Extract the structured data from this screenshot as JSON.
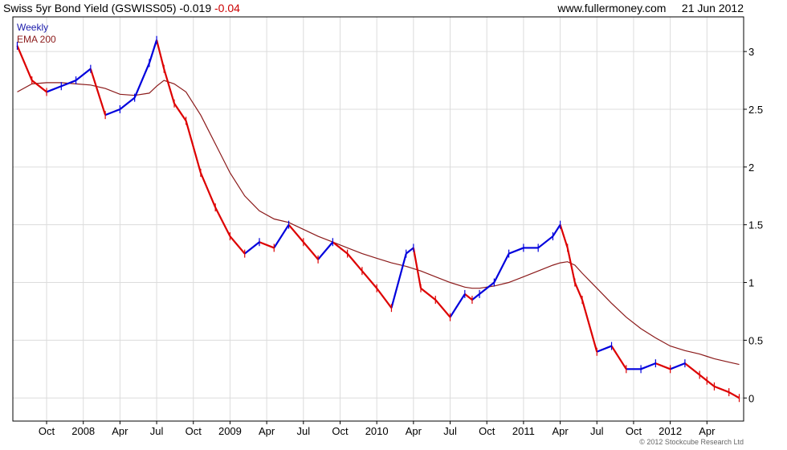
{
  "header": {
    "title": "Swiss 5yr Bond Yield (GSWISS05)",
    "last_value": "-0.019",
    "change": "-0.04",
    "site": "www.fullermoney.com",
    "date": "21 Jun 2012"
  },
  "legend": {
    "weekly": "Weekly",
    "ema": "EMA 200"
  },
  "footer": {
    "copyright": "© 2012 Stockcube Research Ltd"
  },
  "chart_data": {
    "type": "line",
    "x": [
      2007.55,
      2007.65,
      2007.75,
      2007.85,
      2007.95,
      2008.05,
      2008.15,
      2008.25,
      2008.35,
      2008.45,
      2008.5,
      2008.55,
      2008.62,
      2008.7,
      2008.8,
      2008.9,
      2009.0,
      2009.1,
      2009.2,
      2009.3,
      2009.4,
      2009.5,
      2009.6,
      2009.7,
      2009.8,
      2009.9,
      2010.0,
      2010.1,
      2010.2,
      2010.25,
      2010.3,
      2010.4,
      2010.5,
      2010.6,
      2010.65,
      2010.7,
      2010.8,
      2010.9,
      2011.0,
      2011.1,
      2011.2,
      2011.25,
      2011.3,
      2011.35,
      2011.4,
      2011.5,
      2011.6,
      2011.7,
      2011.8,
      2011.9,
      2012.0,
      2012.1,
      2012.2,
      2012.25,
      2012.3,
      2012.4,
      2012.47
    ],
    "series": [
      {
        "name": "Weekly",
        "color_up": "#0000dd",
        "color_down": "#dd0000",
        "values": [
          3.05,
          2.75,
          2.65,
          2.7,
          2.75,
          2.85,
          2.45,
          2.5,
          2.6,
          2.9,
          3.1,
          2.85,
          2.55,
          2.4,
          1.95,
          1.65,
          1.4,
          1.25,
          1.35,
          1.3,
          1.5,
          1.35,
          1.2,
          1.35,
          1.25,
          1.1,
          0.95,
          0.78,
          1.25,
          1.3,
          0.95,
          0.85,
          0.7,
          0.9,
          0.85,
          0.9,
          1.0,
          1.25,
          1.3,
          1.3,
          1.4,
          1.5,
          1.3,
          1.0,
          0.85,
          0.4,
          0.45,
          0.25,
          0.25,
          0.3,
          0.25,
          0.3,
          0.2,
          0.15,
          0.1,
          0.05,
          0.0
        ]
      },
      {
        "name": "EMA 200",
        "color": "#8b1a1a",
        "values": [
          2.65,
          2.72,
          2.73,
          2.73,
          2.72,
          2.71,
          2.68,
          2.63,
          2.62,
          2.64,
          2.7,
          2.75,
          2.72,
          2.65,
          2.45,
          2.2,
          1.95,
          1.75,
          1.62,
          1.55,
          1.52,
          1.46,
          1.4,
          1.35,
          1.3,
          1.25,
          1.21,
          1.17,
          1.14,
          1.12,
          1.1,
          1.05,
          1.0,
          0.96,
          0.95,
          0.95,
          0.97,
          1.0,
          1.05,
          1.1,
          1.15,
          1.17,
          1.18,
          1.15,
          1.08,
          0.95,
          0.82,
          0.7,
          0.6,
          0.52,
          0.45,
          0.41,
          0.38,
          0.36,
          0.34,
          0.31,
          0.29
        ]
      }
    ],
    "x_ticks": [
      {
        "x": 2007.75,
        "label": "Oct"
      },
      {
        "x": 2008.0,
        "label": "2008"
      },
      {
        "x": 2008.25,
        "label": "Apr"
      },
      {
        "x": 2008.5,
        "label": "Jul"
      },
      {
        "x": 2008.75,
        "label": "Oct"
      },
      {
        "x": 2009.0,
        "label": "2009"
      },
      {
        "x": 2009.25,
        "label": "Apr"
      },
      {
        "x": 2009.5,
        "label": "Jul"
      },
      {
        "x": 2009.75,
        "label": "Oct"
      },
      {
        "x": 2010.0,
        "label": "2010"
      },
      {
        "x": 2010.25,
        "label": "Apr"
      },
      {
        "x": 2010.5,
        "label": "Jul"
      },
      {
        "x": 2010.75,
        "label": "Oct"
      },
      {
        "x": 2011.0,
        "label": "2011"
      },
      {
        "x": 2011.25,
        "label": "Apr"
      },
      {
        "x": 2011.5,
        "label": "Jul"
      },
      {
        "x": 2011.75,
        "label": "Oct"
      },
      {
        "x": 2012.0,
        "label": "2012"
      },
      {
        "x": 2012.25,
        "label": "Apr"
      }
    ],
    "y_ticks": [
      0,
      0.5,
      1,
      1.5,
      2,
      2.5,
      3
    ],
    "y_tick_labels": [
      "0",
      "0.5",
      "1",
      "1.5",
      "2",
      "2.5",
      "3"
    ],
    "xlim": [
      2007.52,
      2012.5
    ],
    "ylim": [
      -0.2,
      3.3
    ],
    "grid": true,
    "axis_side": "right",
    "legend_position": "top-left"
  }
}
